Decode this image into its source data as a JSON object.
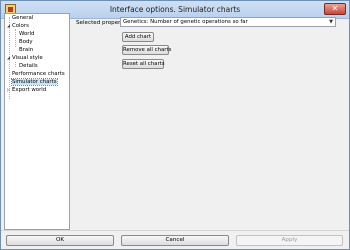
{
  "window": {
    "title": "Interface options. Simulator charts"
  },
  "tree": {
    "items": [
      {
        "label": "General",
        "expander": ""
      },
      {
        "label": "Colors",
        "expander": "◢"
      },
      {
        "label": "World",
        "expander": ""
      },
      {
        "label": "Body",
        "expander": ""
      },
      {
        "label": "Brain",
        "expander": ""
      },
      {
        "label": "Visual style",
        "expander": "◢"
      },
      {
        "label": "Details",
        "expander": ""
      },
      {
        "label": "Performance charts",
        "expander": ""
      },
      {
        "label": "Simulator charts",
        "expander": "",
        "selected": true
      },
      {
        "label": "Export world",
        "expander": "▷"
      }
    ]
  },
  "panel": {
    "selected_property_label": "Selected property",
    "property_value": "Genetics: Number of genetic operations so far",
    "add_chart": "Add chart",
    "remove_all_charts": "Remove all charts",
    "reset_all_charts": "Reset all charts"
  },
  "footer": {
    "ok": "OK",
    "cancel": "Cancel",
    "apply": "Apply"
  }
}
